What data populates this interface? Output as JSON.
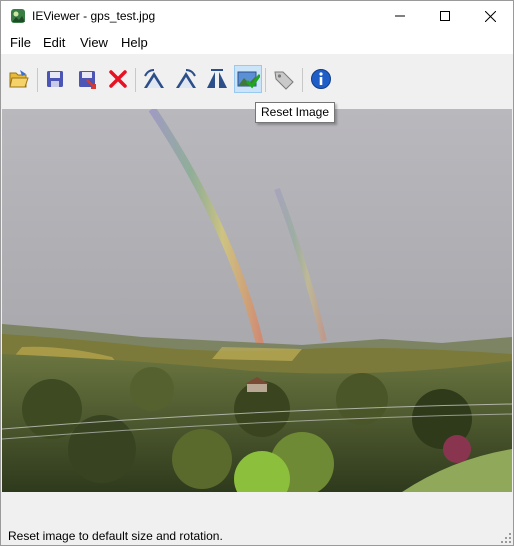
{
  "window": {
    "title": "IEViewer - gps_test.jpg",
    "controls": [
      "minimize",
      "maximize",
      "close"
    ]
  },
  "menu": {
    "items": [
      {
        "label": "File"
      },
      {
        "label": "Edit"
      },
      {
        "label": "View"
      },
      {
        "label": "Help"
      }
    ]
  },
  "toolbar": {
    "buttons": [
      {
        "name": "open",
        "icon": "open-folder-icon"
      },
      {
        "name": "save",
        "icon": "floppy-disk-icon"
      },
      {
        "name": "save-as",
        "icon": "save-as-icon"
      },
      {
        "name": "delete",
        "icon": "red-x-icon"
      },
      {
        "name": "rotate-left",
        "icon": "rotate-left-icon"
      },
      {
        "name": "rotate-right",
        "icon": "rotate-right-icon"
      },
      {
        "name": "flip",
        "icon": "flip-icon"
      },
      {
        "name": "reset-image",
        "icon": "reset-image-icon",
        "active": true
      },
      {
        "name": "tags",
        "icon": "tag-icon"
      },
      {
        "name": "info",
        "icon": "info-icon"
      }
    ],
    "tooltip": "Reset Image"
  },
  "viewer": {
    "image_description_icon": "landscape-photo"
  },
  "status": {
    "text": "Reset image to default size and rotation."
  },
  "colors": {
    "accent_active": "#cce4f7",
    "delete_red": "#e81123",
    "info_blue": "#1f5ec6"
  }
}
